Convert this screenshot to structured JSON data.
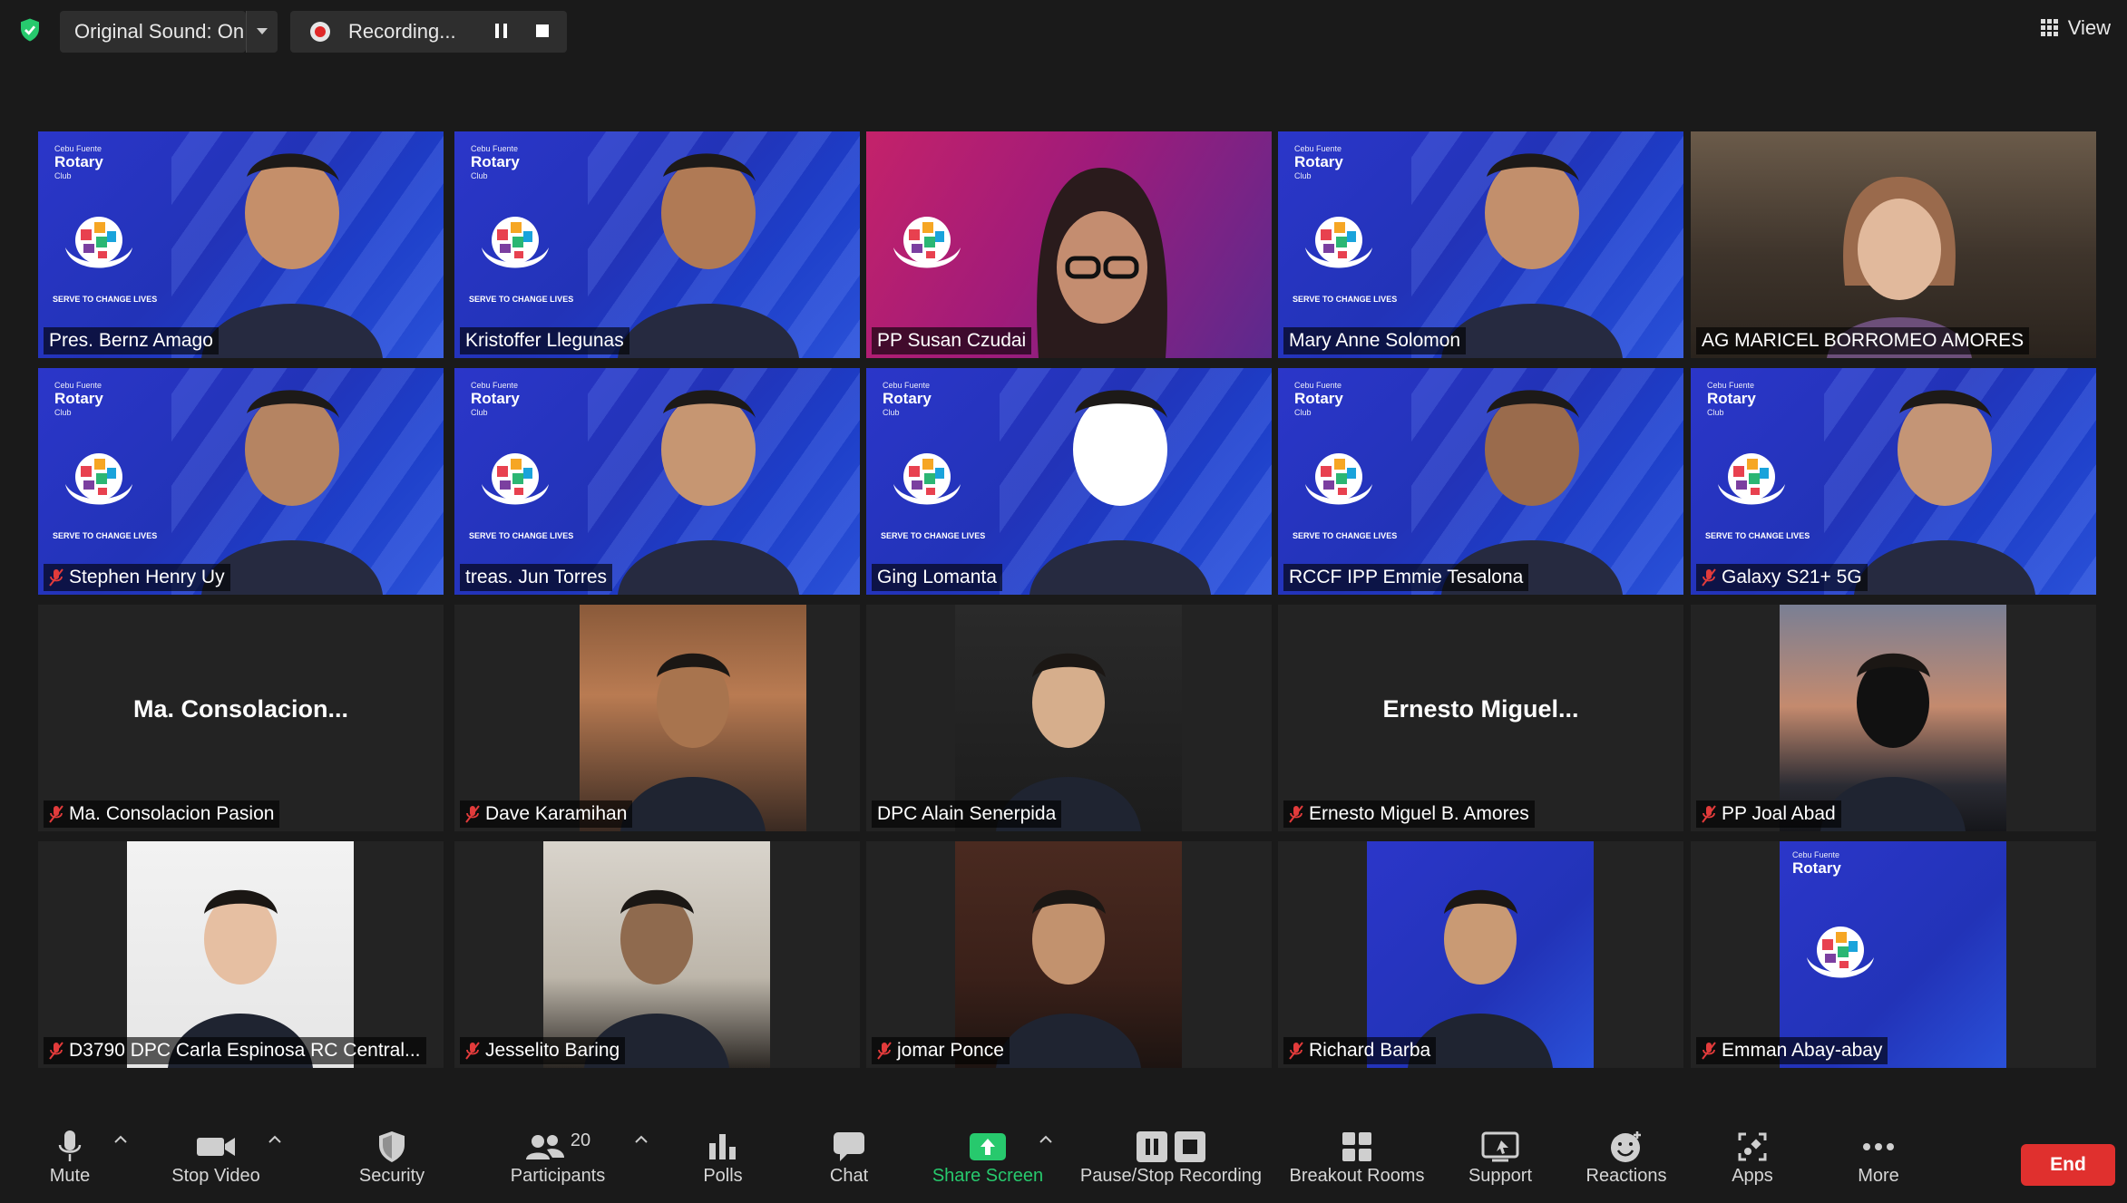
{
  "topbar": {
    "original_sound": "Original Sound: On",
    "recording": "Recording...",
    "view": "View"
  },
  "participants": [
    {
      "name": "Pres. Bernz Amago",
      "muted": false,
      "active": true,
      "bg": "rotary"
    },
    {
      "name": "Kristoffer Llegunas",
      "muted": false,
      "bg": "rotary"
    },
    {
      "name": "PP Susan Czudai",
      "muted": false,
      "bg": "magenta"
    },
    {
      "name": "Mary Anne Solomon",
      "muted": false,
      "bg": "rotary"
    },
    {
      "name": "AG MARICEL BORROMEO AMORES",
      "muted": false,
      "bg": "room"
    },
    {
      "name": "Stephen Henry Uy",
      "muted": true,
      "bg": "rotary"
    },
    {
      "name": "treas. Jun Torres",
      "muted": false,
      "bg": "rotary"
    },
    {
      "name": "Ging Lomanta",
      "muted": false,
      "bg": "rotary"
    },
    {
      "name": "RCCF IPP Emmie Tesalona",
      "muted": false,
      "bg": "rotary"
    },
    {
      "name": "Galaxy S21+ 5G",
      "muted": true,
      "bg": "rotary"
    },
    {
      "name": "Ma. Consolacion Pasion",
      "muted": true,
      "center": "Ma.  Consolacion..."
    },
    {
      "name": "Dave Karamihan",
      "muted": true,
      "bg": "photo"
    },
    {
      "name": "DPC Alain Senerpida",
      "muted": false,
      "bg": "photo"
    },
    {
      "name": "Ernesto Miguel B. Amores",
      "muted": true,
      "center": "Ernesto Miguel..."
    },
    {
      "name": "PP Joal Abad",
      "muted": true,
      "bg": "photo"
    },
    {
      "name": "D3790 DPC Carla Espinosa RC Central...",
      "muted": true,
      "bg": "photo"
    },
    {
      "name": "Jesselito Baring",
      "muted": true,
      "bg": "photo"
    },
    {
      "name": "jomar Ponce",
      "muted": true,
      "bg": "photo"
    },
    {
      "name": "Richard Barba",
      "muted": true,
      "bg": "photo"
    },
    {
      "name": "Emman Abay-abay",
      "muted": true,
      "bg": "photo"
    }
  ],
  "rotary": {
    "club_line": "Cebu Fuente",
    "brand": "Rotary",
    "club": "Club",
    "serve": "SERVE TO CHANGE LIVES"
  },
  "toolbar": {
    "mute": "Mute",
    "stop_video": "Stop Video",
    "security": "Security",
    "participants": "Participants",
    "participants_count": "20",
    "polls": "Polls",
    "chat": "Chat",
    "share_screen": "Share Screen",
    "pause_stop": "Pause/Stop Recording",
    "breakout": "Breakout Rooms",
    "support": "Support",
    "reactions": "Reactions",
    "apps": "Apps",
    "more": "More",
    "end": "End"
  },
  "colors": {
    "active_outline": "#d8e85a",
    "share_green": "#27c96d",
    "end_red": "#e0302e",
    "rotary_blue": "#2233b8"
  }
}
